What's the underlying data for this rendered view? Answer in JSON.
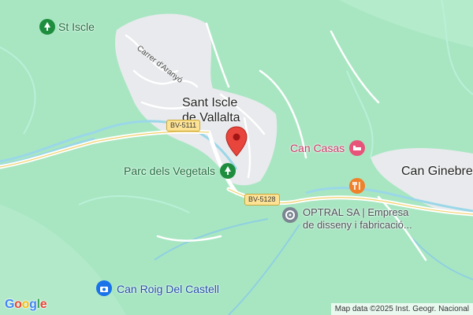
{
  "map": {
    "places": {
      "town_line1": "Sant Iscle",
      "town_line2": "de Vallalta",
      "can_ginebre": "Can Ginebre"
    },
    "pois": {
      "st_iscle": "St Iscle",
      "parc": "Parc dels Vegetals",
      "can_casas": "Can Casas",
      "optral_line1": "OPTRAL SA | Empresa",
      "optral_line2": "de disseny i fabricació...",
      "can_roig": "Can Roig Del Castell"
    },
    "streets": {
      "carrer": "Carrer d'Aranyó"
    },
    "roads": {
      "bv5111": "BV-5111",
      "bv5128": "BV-5128"
    },
    "attribution": "Map data ©2025 Inst. Geogr. Nacional",
    "logo": "Google",
    "colors": {
      "park": "#a8e6c2",
      "urban": "#e8eaed",
      "water": "#9ad7e8",
      "marker": "#e8453c",
      "green_poi": "#1e8e3e",
      "pink_poi": "#e8537a",
      "orange_poi": "#f0802a",
      "blue_poi": "#1a73e8"
    },
    "icons": [
      "tree-icon",
      "bed-icon",
      "restaurant-icon",
      "business-icon",
      "camera-icon",
      "location-pin-icon"
    ]
  }
}
